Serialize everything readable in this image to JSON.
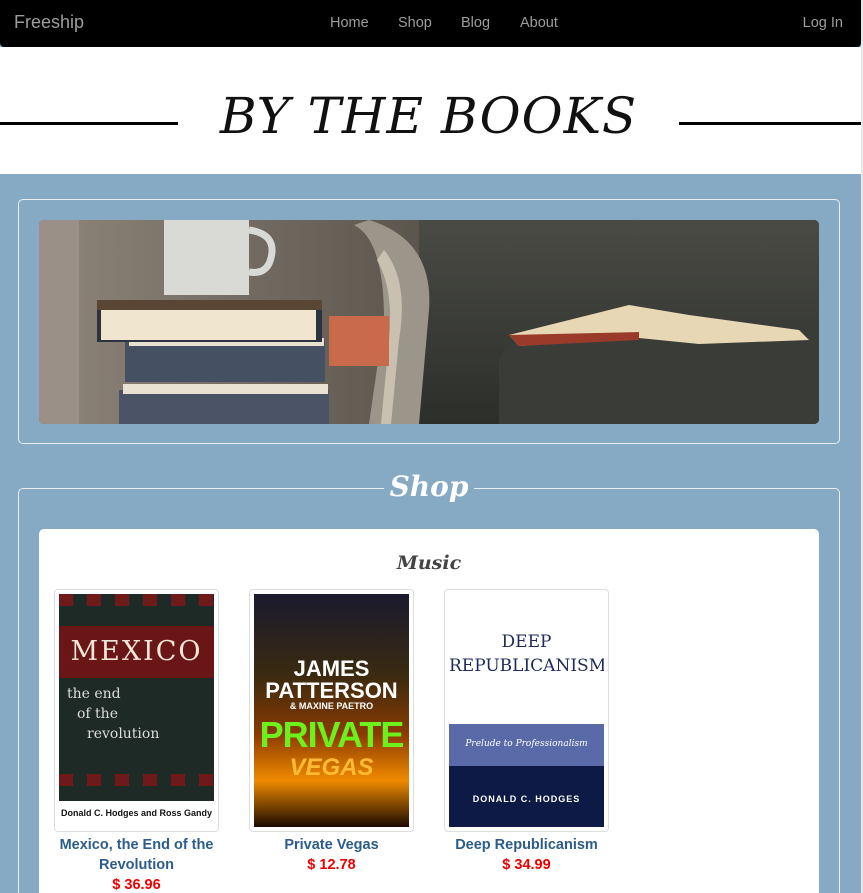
{
  "navbar": {
    "brand": "Freeship",
    "items": [
      {
        "label": "Home"
      },
      {
        "label": "Shop"
      },
      {
        "label": "Blog"
      },
      {
        "label": "About"
      }
    ],
    "login": "Log In"
  },
  "header": {
    "title": "BY THE BOOKS"
  },
  "hero": {
    "icon": "reading-chair-photo"
  },
  "shop": {
    "title": "Shop",
    "category": "Music",
    "books": [
      {
        "title": "Mexico, the End of the Revolution",
        "price": "$ 36.96",
        "cover": {
          "headline": "MEXICO",
          "line1": "the end",
          "line2": "of the",
          "line3": "revolution",
          "authors": "Donald C. Hodges and Ross Gandy"
        }
      },
      {
        "title": "Private Vegas",
        "price": "$ 12.78",
        "cover": {
          "author1": "JAMES",
          "author2": "PATTERSON",
          "tag": "& MAXINE PAETRO",
          "word1": "PRIVATE",
          "word2": "VEGAS"
        }
      },
      {
        "title": "Deep Republicanism",
        "price": "$ 34.99",
        "cover": {
          "line1": "DEEP",
          "line2": "REPUBLICANISM",
          "subtitle": "Prelude to Professionalism",
          "author": "DONALD C. HODGES"
        }
      }
    ]
  },
  "colors": {
    "navbar": "#000000",
    "page_background": "#86a9c4",
    "link": "#2c5d8a",
    "price": "#ee0000"
  }
}
